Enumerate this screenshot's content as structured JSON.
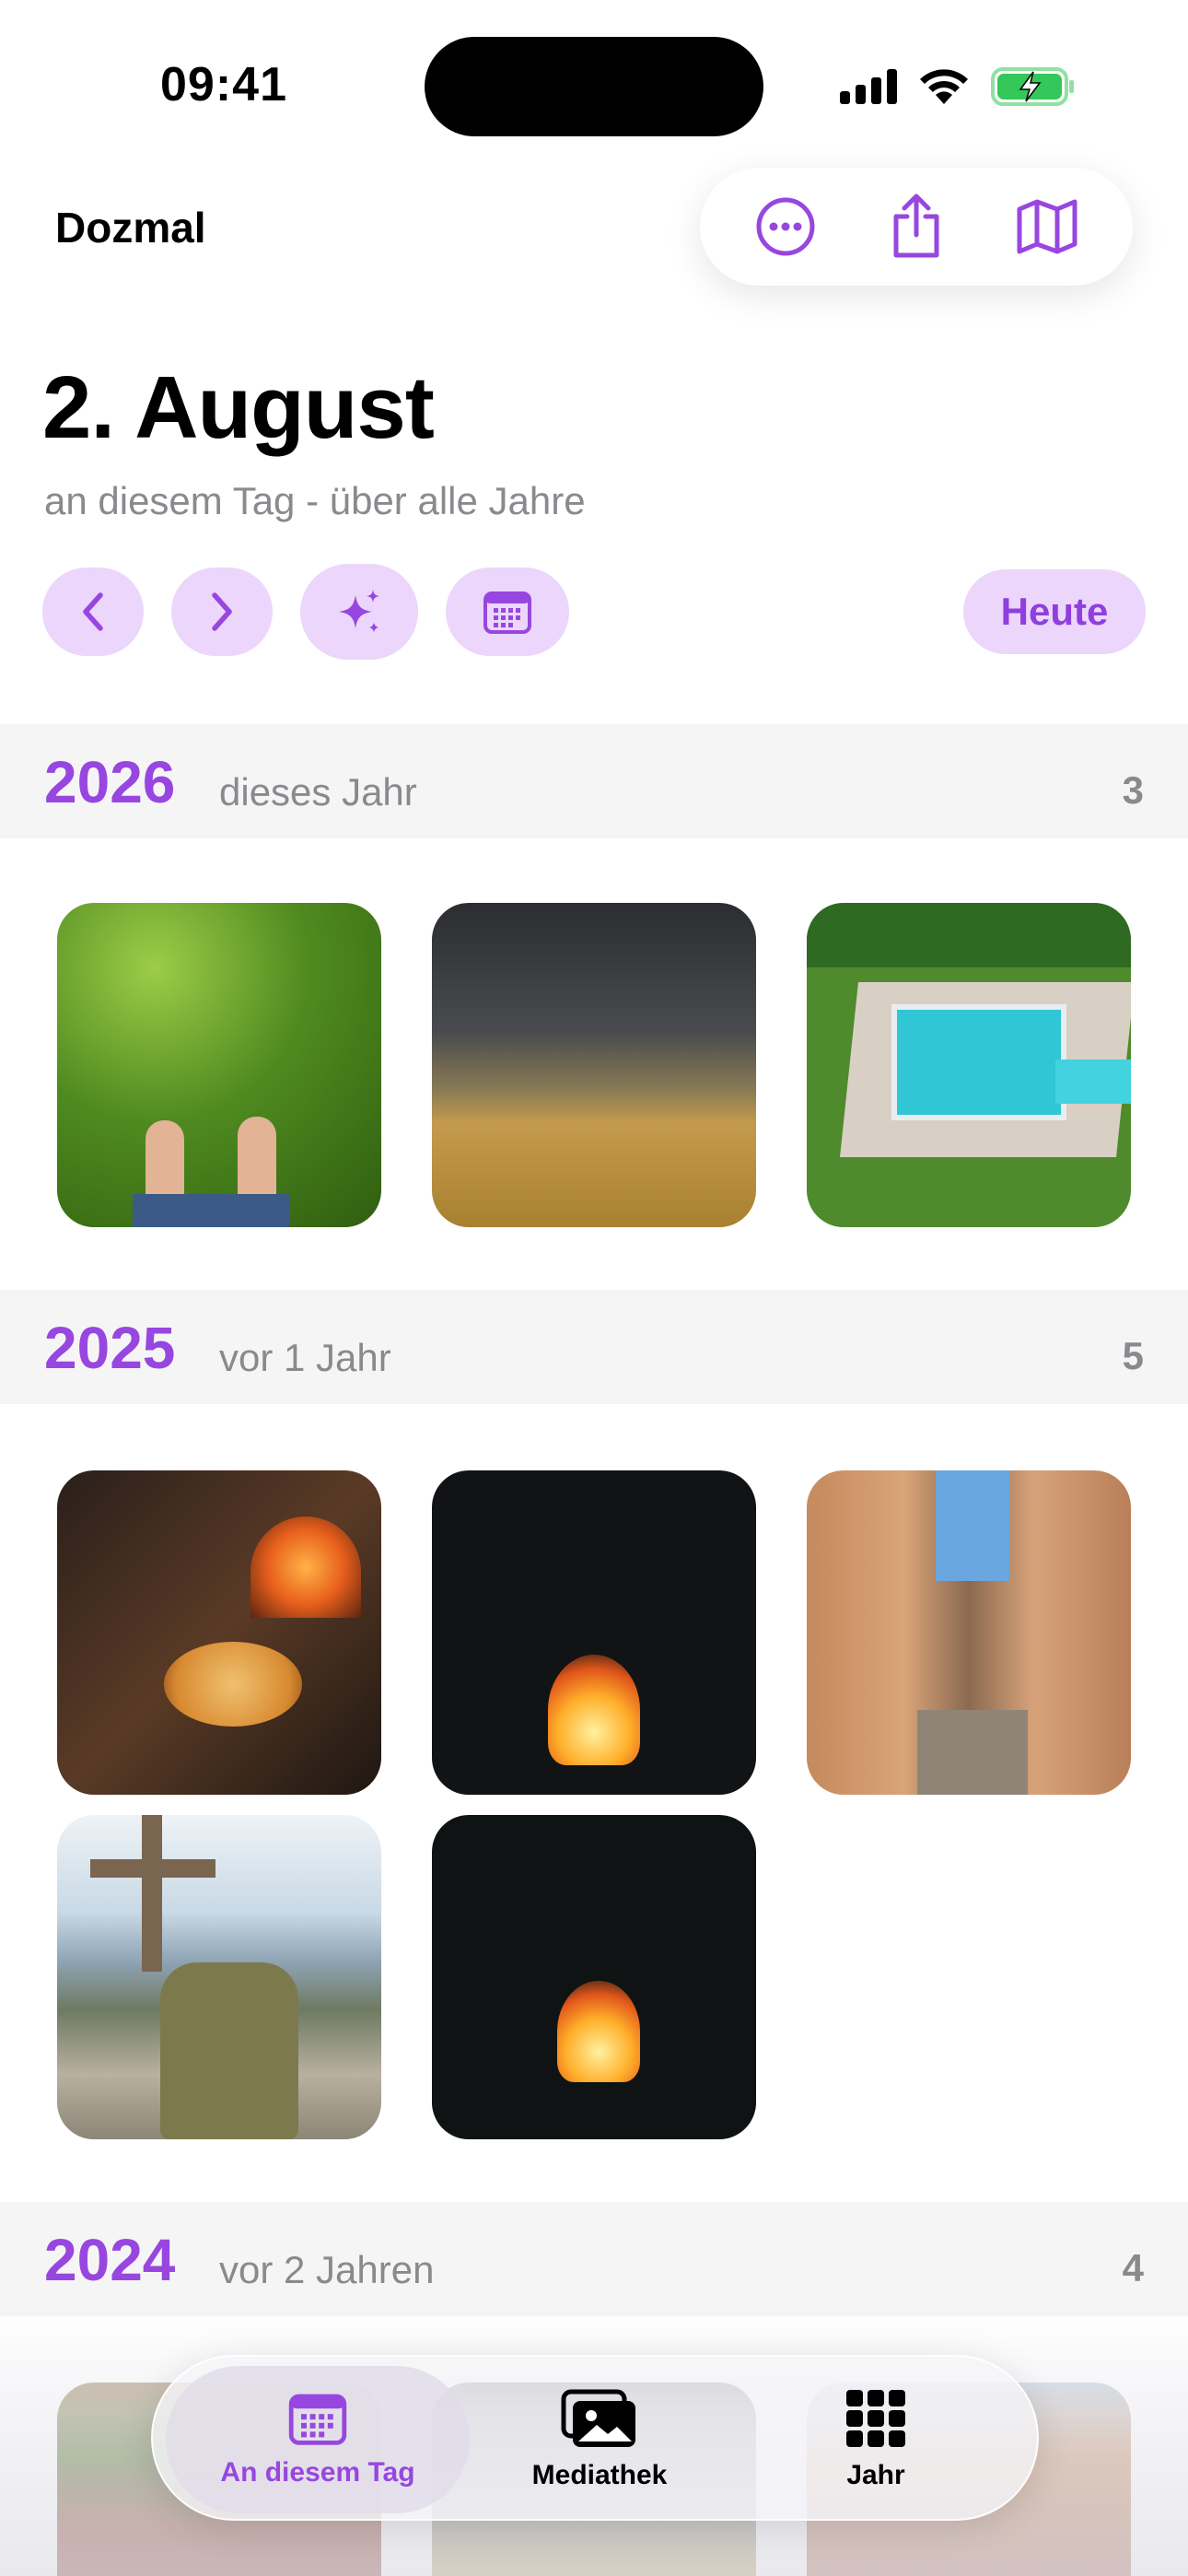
{
  "status_bar": {
    "time": "09:41"
  },
  "header": {
    "app_name": "Dozmal"
  },
  "actions": {
    "more_icon": "ellipsis-circle-icon",
    "share_icon": "share-icon",
    "map_icon": "map-icon"
  },
  "title": {
    "date": "2. August",
    "subtitle": "an diesem Tag - über alle Jahre"
  },
  "controls": {
    "today_label": "Heute"
  },
  "years": [
    {
      "year": "2026",
      "relative": "dieses Jahr",
      "count": "3"
    },
    {
      "year": "2025",
      "relative": "vor 1 Jahr",
      "count": "5"
    },
    {
      "year": "2024",
      "relative": "vor 2 Jahren",
      "count": "4"
    }
  ],
  "tabs": [
    {
      "label": "An diesem Tag",
      "active": true
    },
    {
      "label": "Mediathek",
      "active": false
    },
    {
      "label": "Jahr",
      "active": false
    }
  ],
  "colors": {
    "accent": "#9747df",
    "accent_light": "#ecd6fb"
  }
}
